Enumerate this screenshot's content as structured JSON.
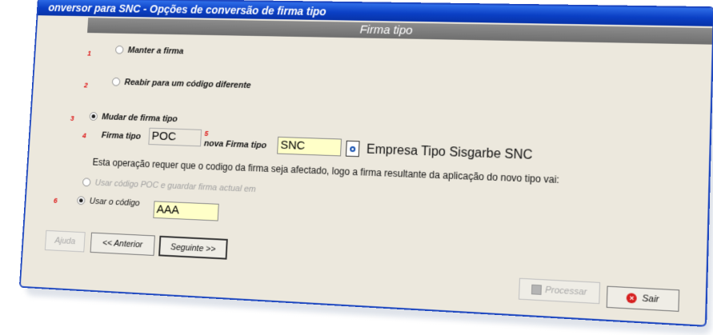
{
  "window": {
    "title": "onversor para SNC - Opções de conversão de firma tipo"
  },
  "header": {
    "title": "Firma tipo"
  },
  "options": [
    {
      "num": "1",
      "label": "Manter a firma"
    },
    {
      "num": "2",
      "label": "Reabir para um código diferente"
    },
    {
      "num": "3",
      "label": "Mudar de firma tipo"
    }
  ],
  "conversion": {
    "num_4": "4",
    "num_5": "5",
    "firma_tipo_label": "Firma tipo",
    "firma_tipo_value": "POC",
    "nova_firma_tipo_label": "nova Firma tipo",
    "nova_firma_tipo_value": "SNC",
    "description": "Empresa Tipo Sisgarbe SNC"
  },
  "info_text": "Esta operação requer que o codigo da firma seja afectado, logo a firma resultante da aplicação do novo tipo vai:",
  "sub_options": {
    "keep_poc_label": "Usar código POC e guardar firma actual em",
    "num_6": "6",
    "use_code_label": "Usar o código",
    "use_code_value": "AAA"
  },
  "buttons": {
    "help": "Ajuda",
    "previous": "<< Anterior",
    "next": "Seguinte >>",
    "process": "Processar",
    "exit": "Sair"
  }
}
